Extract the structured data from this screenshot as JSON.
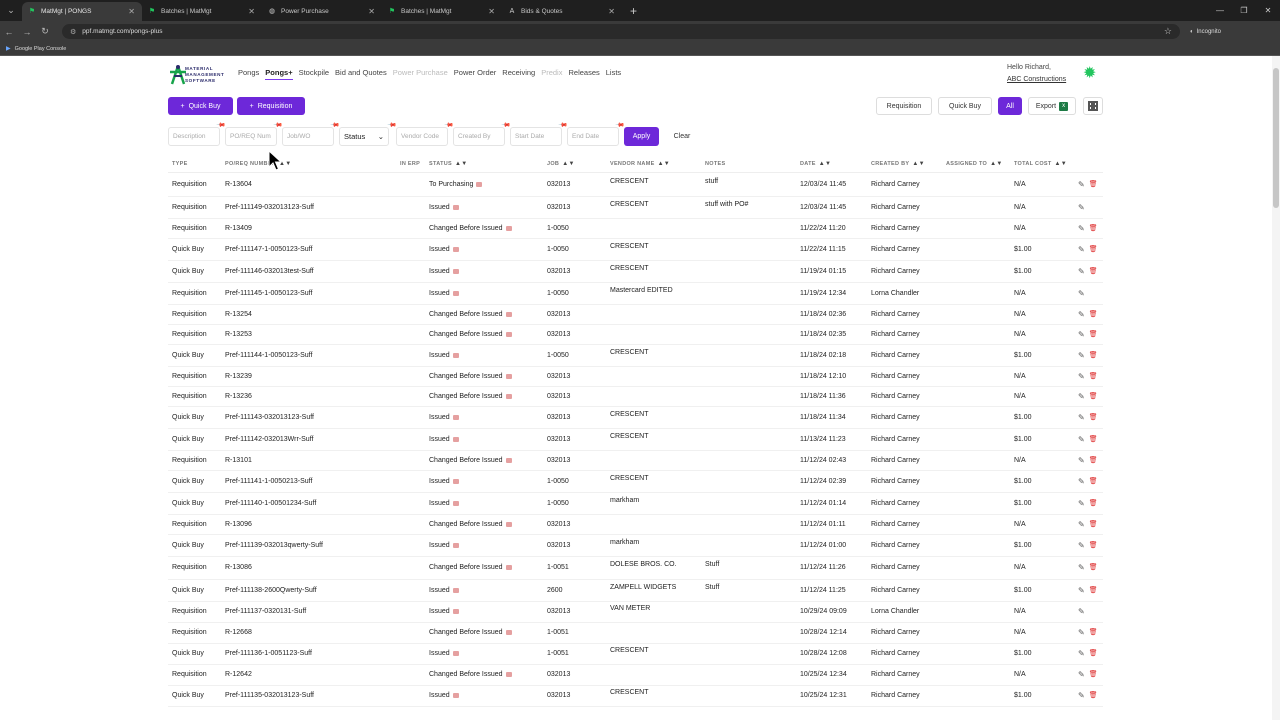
{
  "browser": {
    "tabs": [
      {
        "title": "MatMgt | PONGS",
        "active": true,
        "icon": "matmgt-icon"
      },
      {
        "title": "Batches | MatMgt",
        "active": false,
        "icon": "matmgt-icon"
      },
      {
        "title": "Power Purchase",
        "active": false,
        "icon": "globe-icon"
      },
      {
        "title": "Batches | MatMgt",
        "active": false,
        "icon": "matmgt-icon"
      },
      {
        "title": "Bids & Quotes",
        "active": false,
        "icon": "a-icon"
      }
    ],
    "url": "ppf.matmgt.com/pongs-plus",
    "incognito_label": "Incognito",
    "bookmark": "Google Play Console"
  },
  "app": {
    "logo_lines": [
      "MATERIAL",
      "MANAGEMENT",
      "SOFTWARE"
    ],
    "nav": [
      {
        "label": "Pongs",
        "state": "normal"
      },
      {
        "label": "Pongs+",
        "state": "active"
      },
      {
        "label": "Stockpile",
        "state": "normal"
      },
      {
        "label": "Bid and Quotes",
        "state": "normal"
      },
      {
        "label": "Power Purchase",
        "state": "dim"
      },
      {
        "label": "Power Order",
        "state": "normal"
      },
      {
        "label": "Receiving",
        "state": "normal"
      },
      {
        "label": "Predix",
        "state": "dim"
      },
      {
        "label": "Releases",
        "state": "normal"
      },
      {
        "label": "Lists",
        "state": "normal"
      }
    ],
    "greeting": "Hello Richard,",
    "company": "ABC Constructions",
    "accent": "#6d28d9"
  },
  "toolbar": {
    "quick_buy": "Quick Buy",
    "requisition": "Requisition",
    "filter_requisition": "Requisition",
    "filter_quick_buy": "Quick Buy",
    "filter_all": "All",
    "export": "Export"
  },
  "filters": {
    "description": "Description",
    "po_req": "PO/REQ Num",
    "job": "Job/WO",
    "status": "Status",
    "vendor_code": "Vendor Code",
    "created_by": "Created By",
    "start_date": "Start Date",
    "end_date": "End Date",
    "apply": "Apply",
    "clear": "Clear"
  },
  "table": {
    "headers": {
      "type": "TYPE",
      "po": "PO/REQ NUMBER",
      "erp": "IN ERP",
      "status": "STATUS",
      "job": "JOB",
      "vendor": "VENDOR NAME",
      "notes": "NOTES",
      "date": "DATE",
      "created": "CREATED BY",
      "assigned": "ASSIGNED TO",
      "cost": "TOTAL COST"
    },
    "rows": [
      {
        "type": "Requisition",
        "po": "R-13604",
        "status": "To Purchasing",
        "job": "032013",
        "vendor": "CRESCENT",
        "notes": "stuff",
        "date": "12/03/24 11:45",
        "created": "Richard Carney",
        "cost": "N/A",
        "trash": true,
        "h": 23
      },
      {
        "type": "Requisition",
        "po": "Pref-111149-032013123-Suff",
        "status": "Issued",
        "job": "032013",
        "vendor": "CRESCENT",
        "notes": "stuff with PO#",
        "date": "12/03/24 11:45",
        "created": "Richard Carney",
        "cost": "N/A",
        "trash": false,
        "h": 22
      },
      {
        "type": "Requisition",
        "po": "R-13409",
        "status": "Changed Before Issued",
        "job": "1-0050",
        "vendor": "",
        "notes": "",
        "date": "11/22/24 11:20",
        "created": "Richard Carney",
        "cost": "N/A",
        "trash": true,
        "h": 20
      },
      {
        "type": "Quick Buy",
        "po": "Pref-111147-1-0050123-Suff",
        "status": "Issued",
        "job": "1-0050",
        "vendor": "CRESCENT",
        "notes": "",
        "date": "11/22/24 11:15",
        "created": "Richard Carney",
        "cost": "$1.00",
        "trash": true,
        "h": 22
      },
      {
        "type": "Quick Buy",
        "po": "Pref-111146-032013test-Suff",
        "status": "Issued",
        "job": "032013",
        "vendor": "CRESCENT",
        "notes": "",
        "date": "11/19/24 01:15",
        "created": "Richard Carney",
        "cost": "$1.00",
        "trash": true,
        "h": 22
      },
      {
        "type": "Requisition",
        "po": "Pref-111145-1-0050123-Suff",
        "status": "Issued",
        "job": "1-0050",
        "vendor": "Mastercard EDITED",
        "notes": "",
        "date": "11/19/24 12:34",
        "created": "Lorna Chandler",
        "cost": "N/A",
        "trash": false,
        "h": 22
      },
      {
        "type": "Requisition",
        "po": "R-13254",
        "status": "Changed Before Issued",
        "job": "032013",
        "vendor": "",
        "notes": "",
        "date": "11/18/24 02:36",
        "created": "Richard Carney",
        "cost": "N/A",
        "trash": true,
        "h": 20
      },
      {
        "type": "Requisition",
        "po": "R-13253",
        "status": "Changed Before Issued",
        "job": "032013",
        "vendor": "",
        "notes": "",
        "date": "11/18/24 02:35",
        "created": "Richard Carney",
        "cost": "N/A",
        "trash": true,
        "h": 20
      },
      {
        "type": "Quick Buy",
        "po": "Pref-111144-1-0050123-Suff",
        "status": "Issued",
        "job": "1-0050",
        "vendor": "CRESCENT",
        "notes": "",
        "date": "11/18/24 02:18",
        "created": "Richard Carney",
        "cost": "$1.00",
        "trash": true,
        "h": 22
      },
      {
        "type": "Requisition",
        "po": "R-13239",
        "status": "Changed Before Issued",
        "job": "032013",
        "vendor": "",
        "notes": "",
        "date": "11/18/24 12:10",
        "created": "Richard Carney",
        "cost": "N/A",
        "trash": true,
        "h": 20
      },
      {
        "type": "Requisition",
        "po": "R-13236",
        "status": "Changed Before Issued",
        "job": "032013",
        "vendor": "",
        "notes": "",
        "date": "11/18/24 11:36",
        "created": "Richard Carney",
        "cost": "N/A",
        "trash": true,
        "h": 20
      },
      {
        "type": "Quick Buy",
        "po": "Pref-111143-032013123-Suff",
        "status": "Issued",
        "job": "032013",
        "vendor": "CRESCENT",
        "notes": "",
        "date": "11/18/24 11:34",
        "created": "Richard Carney",
        "cost": "$1.00",
        "trash": true,
        "h": 22
      },
      {
        "type": "Quick Buy",
        "po": "Pref-111142-032013Wrr-Suff",
        "status": "Issued",
        "job": "032013",
        "vendor": "CRESCENT",
        "notes": "",
        "date": "11/13/24 11:23",
        "created": "Richard Carney",
        "cost": "$1.00",
        "trash": true,
        "h": 22
      },
      {
        "type": "Requisition",
        "po": "R-13101",
        "status": "Changed Before Issued",
        "job": "032013",
        "vendor": "",
        "notes": "",
        "date": "11/12/24 02:43",
        "created": "Richard Carney",
        "cost": "N/A",
        "trash": true,
        "h": 20
      },
      {
        "type": "Quick Buy",
        "po": "Pref-111141-1-0050213-Suff",
        "status": "Issued",
        "job": "1-0050",
        "vendor": "CRESCENT",
        "notes": "",
        "date": "11/12/24 02:39",
        "created": "Richard Carney",
        "cost": "$1.00",
        "trash": true,
        "h": 22
      },
      {
        "type": "Quick Buy",
        "po": "Pref-111140-1-00501234-Suff",
        "status": "Issued",
        "job": "1-0050",
        "vendor": "markham",
        "notes": "",
        "date": "11/12/24 01:14",
        "created": "Richard Carney",
        "cost": "$1.00",
        "trash": true,
        "h": 22
      },
      {
        "type": "Requisition",
        "po": "R-13096",
        "status": "Changed Before Issued",
        "job": "032013",
        "vendor": "",
        "notes": "",
        "date": "11/12/24 01:11",
        "created": "Richard Carney",
        "cost": "N/A",
        "trash": true,
        "h": 20
      },
      {
        "type": "Quick Buy",
        "po": "Pref-111139-032013qwerty-Suff",
        "status": "Issued",
        "job": "032013",
        "vendor": "markham",
        "notes": "",
        "date": "11/12/24 01:00",
        "created": "Richard Carney",
        "cost": "$1.00",
        "trash": true,
        "h": 22
      },
      {
        "type": "Requisition",
        "po": "R-13086",
        "status": "Changed Before Issued",
        "job": "1-0051",
        "vendor": "DOLESE BROS. CO.",
        "notes": "Stuff",
        "date": "11/12/24 11:26",
        "created": "Richard Carney",
        "cost": "N/A",
        "trash": true,
        "h": 23
      },
      {
        "type": "Quick Buy",
        "po": "Pref-111138-2600Qwerty-Suff",
        "status": "Issued",
        "job": "2600",
        "vendor": "ZAMPELL WIDGETS",
        "notes": "Stuff",
        "date": "11/12/24 11:25",
        "created": "Richard Carney",
        "cost": "$1.00",
        "trash": true,
        "h": 22
      },
      {
        "type": "Requisition",
        "po": "Pref-111137-0320131-Suff",
        "status": "Issued",
        "job": "032013",
        "vendor": "VAN METER",
        "notes": "",
        "date": "10/29/24 09:09",
        "created": "Lorna Chandler",
        "cost": "N/A",
        "trash": false,
        "h": 21
      },
      {
        "type": "Requisition",
        "po": "R-12668",
        "status": "Changed Before Issued",
        "job": "1-0051",
        "vendor": "",
        "notes": "",
        "date": "10/28/24 12:14",
        "created": "Richard Carney",
        "cost": "N/A",
        "trash": true,
        "h": 21
      },
      {
        "type": "Quick Buy",
        "po": "Pref-111136-1-0051123-Suff",
        "status": "Issued",
        "job": "1-0051",
        "vendor": "CRESCENT",
        "notes": "",
        "date": "10/28/24 12:08",
        "created": "Richard Carney",
        "cost": "$1.00",
        "trash": true,
        "h": 21
      },
      {
        "type": "Requisition",
        "po": "R-12642",
        "status": "Changed Before Issued",
        "job": "032013",
        "vendor": "",
        "notes": "",
        "date": "10/25/24 12:34",
        "created": "Richard Carney",
        "cost": "N/A",
        "trash": true,
        "h": 21
      },
      {
        "type": "Quick Buy",
        "po": "Pref-111135-032013123-Suff",
        "status": "Issued",
        "job": "032013",
        "vendor": "CRESCENT",
        "notes": "",
        "date": "10/25/24 12:31",
        "created": "Richard Carney",
        "cost": "$1.00",
        "trash": true,
        "h": 21
      }
    ]
  }
}
